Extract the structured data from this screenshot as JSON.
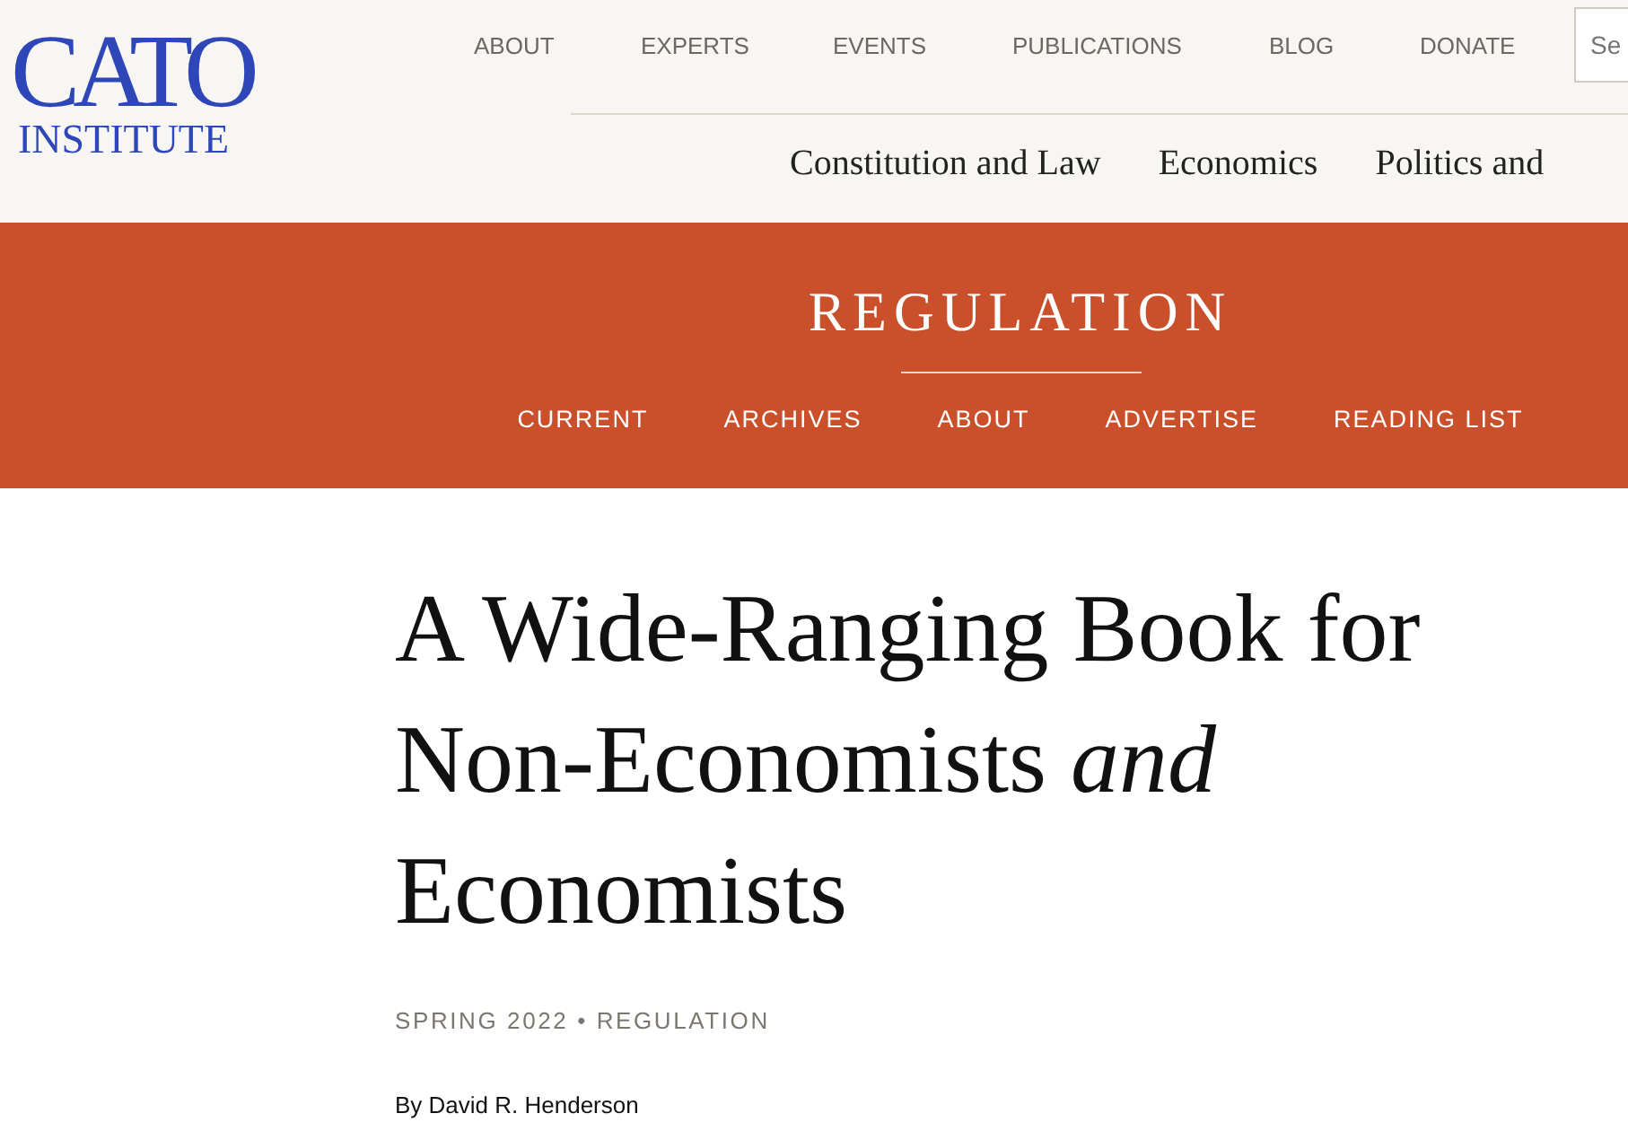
{
  "logo": {
    "name": "CATO",
    "subtitle": "INSTITUTE"
  },
  "top_nav": [
    "ABOUT",
    "EXPERTS",
    "EVENTS",
    "PUBLICATIONS",
    "BLOG",
    "DONATE"
  ],
  "search": {
    "placeholder": "Se"
  },
  "topic_nav": [
    "Constitution and Law",
    "Economics",
    "Politics and"
  ],
  "section": {
    "title": "REGULATION",
    "nav": [
      "CURRENT",
      "ARCHIVES",
      "ABOUT",
      "ADVERTISE",
      "READING LIST"
    ]
  },
  "article": {
    "title": "A Wide-Ranging Book for Non-Economists *and* Economists",
    "meta": "SPRING 2022 • REGULATION",
    "byline": "By David R. Henderson"
  }
}
